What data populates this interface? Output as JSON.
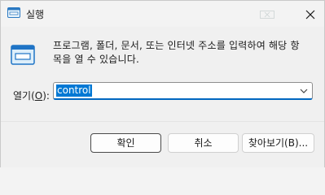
{
  "window": {
    "title": "실행"
  },
  "dialog": {
    "description_line1": "프로그램, 폴더, 문서, 또는 인터넷 주소를 입력하여 해당 항",
    "description_line2": "목을 열 수 있습니다.",
    "open_label_prefix": "열기(",
    "open_label_accel": "O",
    "open_label_suffix": "):",
    "input_value": "control"
  },
  "buttons": {
    "ok": "확인",
    "cancel": "취소",
    "browse": "찾아보기(B)..."
  },
  "icons": {
    "app": "run-icon",
    "close": "close-icon",
    "dropdown": "chevron-down-icon"
  },
  "colors": {
    "accent": "#0078d4",
    "selection_text": "#ffffff"
  }
}
